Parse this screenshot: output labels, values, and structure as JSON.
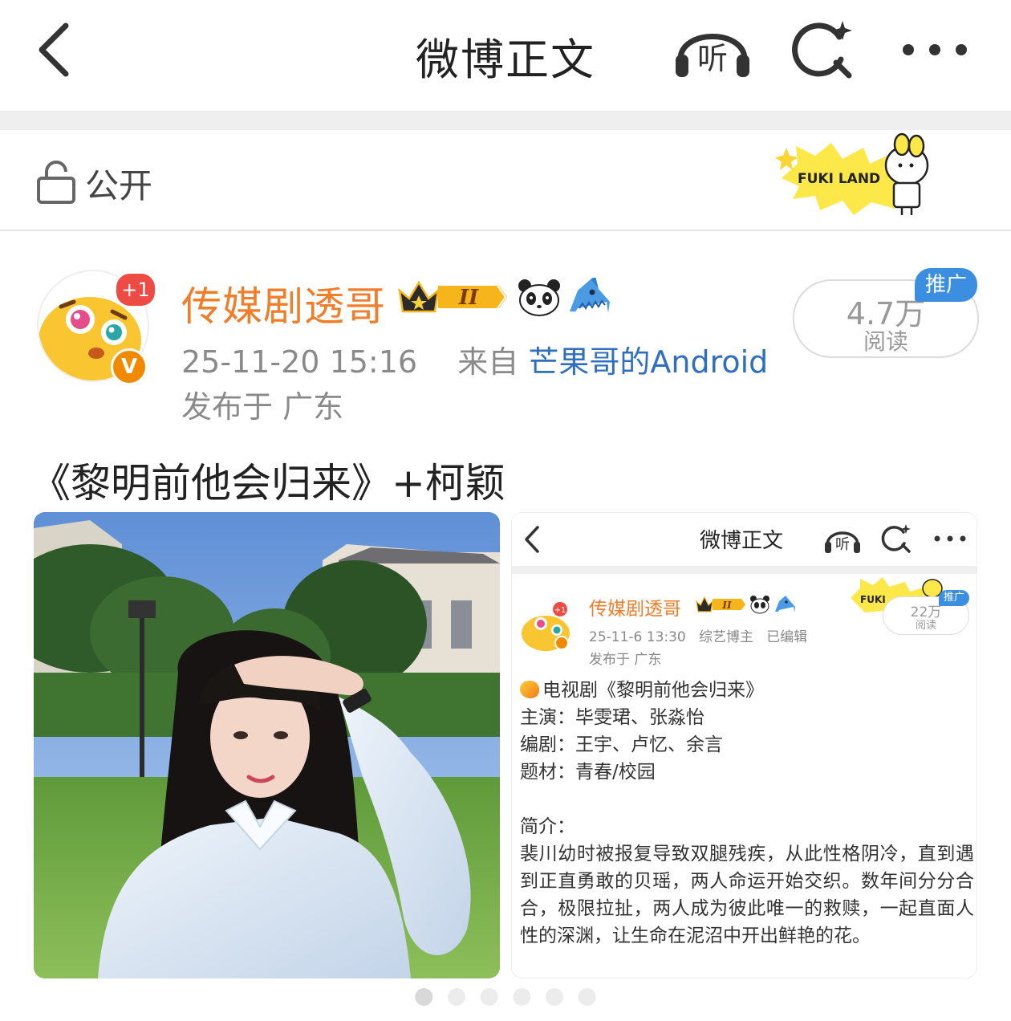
{
  "nav": {
    "title": "微博正文",
    "listen_glyph": "听"
  },
  "visibility": {
    "label": "公开",
    "badge_text": "FUKI LAND"
  },
  "author": {
    "name": "传媒剧透哥",
    "follow_badge": "+1",
    "verified_glyph": "V",
    "level_badge": "II",
    "timestamp": "25-11-20 15:16",
    "source_prefix": "来自",
    "source": "芒果哥的Android",
    "location": "发布于 广东"
  },
  "stats": {
    "reads_count": "4.7万",
    "reads_label": "阅读",
    "promo_tag": "推广"
  },
  "post": {
    "text": "《黎明前他会归来》+柯颖"
  },
  "embedded_screenshot": {
    "title": "微博正文",
    "listen_glyph": "听",
    "author_name": "传媒剧透哥",
    "follow_badge": "+1",
    "level_badge": "II",
    "timestamp": "25-11-6 13:30",
    "category": "综艺博主",
    "edited": "已编辑",
    "location": "发布于 广东",
    "badge_text": "FUKI",
    "reads_count": "22万",
    "reads_label": "阅读",
    "promo_tag": "推广",
    "drama_line": "电视剧《黎明前他会归来》",
    "cast_line": "主演：毕雯珺、张淼怡",
    "writer_line": "编剧：王宇、卢忆、余言",
    "genre_line": "题材：青春/校园",
    "synopsis_label": "简介：",
    "synopsis": "裴川幼时被报复导致双腿残疾，从此性格阴冷，直到遇到正直勇敢的贝瑶，两人命运开始交织。数年间分分合合，极限拉扯，两人成为彼此唯一的救赎，一起直面人性的深渊，让生命在泥沼中开出鲜艳的花。"
  },
  "gallery": {
    "total_images": 6,
    "current_image": 1
  },
  "colors": {
    "author_name": "#ef7d2a",
    "source_link": "#2f6fbd",
    "promo": "#3c8fe0",
    "follow_badge": "#ee4b45"
  }
}
